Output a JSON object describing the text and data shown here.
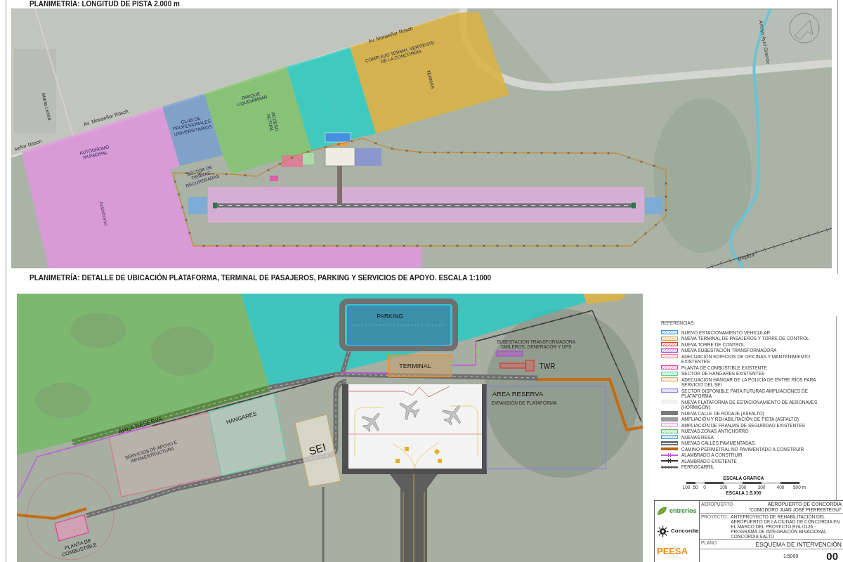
{
  "top_plan": {
    "title": "PLANIMETRÍA: LONGITUD DE PISTA 2.000 m",
    "labels": [
      {
        "kind": "road",
        "lines": [
          "Av. Monseñor Rösch"
        ]
      },
      {
        "kind": "zone",
        "lines": [
          "COMPLEJO TERMAL VERTIENTE",
          "DE LA CONCORDIA"
        ]
      },
      {
        "kind": "zone",
        "lines": [
          "TERMAS"
        ]
      },
      {
        "kind": "water",
        "lines": [
          "Arroyo Ayuí Grande"
        ]
      },
      {
        "kind": "road",
        "lines": [
          "Marta Lessa"
        ]
      },
      {
        "kind": "zone",
        "lines": [
          "PARQUE",
          "LIQUIDAMBAR"
        ]
      },
      {
        "kind": "road",
        "lines": [
          "Av. Monseñor Rösch"
        ]
      },
      {
        "kind": "zone",
        "lines": [
          "ACCESO",
          "ACTUAL"
        ]
      },
      {
        "kind": "zone",
        "lines": [
          "CLUB DE",
          "PROFESIONALES",
          "UNIVERSITARIOS"
        ]
      },
      {
        "kind": "road",
        "lines": [
          "señor Rösch"
        ]
      },
      {
        "kind": "zone",
        "lines": [
          "AUTÓDROMO",
          "MUNICIPAL"
        ]
      },
      {
        "kind": "zone",
        "lines": [
          "SECTOR DE",
          "TIERRAS",
          "RECUPERADAS"
        ]
      },
      {
        "kind": "place",
        "lines": [
          "Autódromo"
        ]
      },
      {
        "kind": "rail",
        "lines": [
          "Urquiza"
        ]
      }
    ]
  },
  "detail_plan": {
    "title": "PLANIMETRÍA: DETALLE DE UBICACIÓN PLATAFORMA, TERMINAL DE PASAJEROS, PARKING Y SERVICIOS DE APOYO. ESCALA 1:1000",
    "labels": [
      {
        "kind": "facility",
        "lines": [
          "PARKING"
        ]
      },
      {
        "kind": "facility",
        "lines": [
          "TERMINAL"
        ]
      },
      {
        "kind": "note",
        "lines": [
          "SUBESTACION TRANSFORMADORA",
          "TABLEROS, GENERADOR Y UPS"
        ]
      },
      {
        "kind": "facility",
        "lines": [
          "TWR"
        ]
      },
      {
        "kind": "facility",
        "lines": [
          "ÁREA RESERVA"
        ]
      },
      {
        "kind": "note",
        "lines": [
          "EXPANSIÓN DE PLATAFORMA"
        ]
      },
      {
        "kind": "facility",
        "lines": [
          "ÁREA RESERVA"
        ]
      },
      {
        "kind": "note",
        "lines": [
          "SERVICIOS DE APOYO E",
          "INFRAESTRUCTURA"
        ]
      },
      {
        "kind": "facility",
        "lines": [
          "HANGARES"
        ]
      },
      {
        "kind": "facility",
        "lines": [
          "SEI"
        ]
      },
      {
        "kind": "facility",
        "lines": [
          "PLANTA DE",
          "COMBUSTIBLE"
        ]
      }
    ]
  },
  "legend": {
    "title": "REFERENCIAS:",
    "items": [
      {
        "kind": "hatch",
        "color": "#3f8fe0",
        "label": "NUEVO ESTACIONAMIENTO VEHICULAR"
      },
      {
        "kind": "hatch",
        "color": "#f09a30",
        "label": "NUEVA TERMINAL DE PASAJEROS Y TORRE DE CONTROL"
      },
      {
        "kind": "hatch",
        "color": "#e03a3a",
        "label": "NUEVA TORRE DE CONTROL"
      },
      {
        "kind": "hatch",
        "color": "#b03ad0",
        "label": "NUEVA SUBESTACIÓN TRANSFORMADORA"
      },
      {
        "kind": "hatch",
        "color": "#f08a8a",
        "label": "ADECUACIÓN EDIFICIOS DE OFICINAS Y MANTENIMIENTO EXISTENTES"
      },
      {
        "kind": "hatch",
        "color": "#e8409a",
        "label": "PLANTA DE COMBUSTIBLE EXISTENTE"
      },
      {
        "kind": "hatch",
        "color": "#58d0a0",
        "label": "SECTOR DE HANGARES EXISTENTES"
      },
      {
        "kind": "hatch",
        "color": "#d2b06a",
        "label": "ADECUACIÓN HANGAR DE LA POLICÍA DE ENTRE RÍOS PARA SERVICIO DEL SEI"
      },
      {
        "kind": "hatch",
        "color": "#8a82e6",
        "label": "SECTOR DISPONIBLE PARA FUTURAS AMPLIACIONES DE PLATAFORMA"
      },
      {
        "kind": "blank",
        "color": "#f2f2f2",
        "label": "NUEVA PLATAFORMA DE ESTACIONAMIENTO DE AERONAVES (HORMIGÓN)"
      },
      {
        "kind": "solid",
        "color": "#7a7a7a",
        "label": "NUEVA CALLE DE RODAJE (ASFALTO)"
      },
      {
        "kind": "solid",
        "color": "#9c9c9c",
        "label": "AMPLIACIÓN Y REHABILITACIÓN DE PISTA (ASFALTO)"
      },
      {
        "kind": "hatch",
        "color": "#f0a8f0",
        "label": "AMPLIACIÓN DE FRANJAS DE SEGURIDAD EXISTENTES"
      },
      {
        "kind": "hatch",
        "color": "#58c058",
        "label": "NUEVAS ZONAS ANTICHORRO"
      },
      {
        "kind": "hatch",
        "color": "#4aa2e2",
        "label": "NUEVAS RESA"
      },
      {
        "kind": "road",
        "color": "#6e6e6e",
        "label": "NUEVAS CALLES PAVIMENTADAS"
      },
      {
        "kind": "bar",
        "color": "#b8620e",
        "label": "CAMINO PERIMETRAL NO PAVIMENTADO A CONSTRUIR"
      },
      {
        "kind": "fence",
        "color": "#c25ae0",
        "label": "ALAMBRADO A CONSTRUIR"
      },
      {
        "kind": "fence",
        "color": "#333333",
        "label": "ALAMBRADO EXISTENTE"
      },
      {
        "kind": "rail",
        "color": "#555555",
        "label": "FERROCARRIL"
      }
    ]
  },
  "scale": {
    "title": "ESCALA GRÁFICA",
    "ticks": [
      "100",
      "50",
      "0",
      "100",
      "200",
      "300",
      "400",
      "500 m"
    ],
    "caption": "ESCALA 1:5.000"
  },
  "title_block": {
    "logos": [
      {
        "kind": "leaf",
        "text": "entrerios"
      },
      {
        "kind": "emblem",
        "text": "Concordia"
      },
      {
        "kind": "wordmark",
        "text": "PEESA"
      }
    ],
    "airport_label": "AEROPUERTO",
    "airport": "AEROPUERTO DE CONCORDIA",
    "airport_name": "\"COMODORO JUAN JOSÉ PIERRESTEGUI\"",
    "project_label": "PROYECTO:",
    "project": "ANTEPROYECTO DE REHABILITACIÓN DEL AEROPUERTO DE LA CIUDAD DE CONCORDIA EN EL MARCO DEL PROYECTO RGL/1126 · PROGRAMA DE INTEGRACIÓN BINACIONAL CONCORDIA SALTO",
    "sheet_label": "PLANO",
    "sheet": "ESQUEMA DE INTERVENCIÓN",
    "scale": "1:5000",
    "number": "00"
  }
}
